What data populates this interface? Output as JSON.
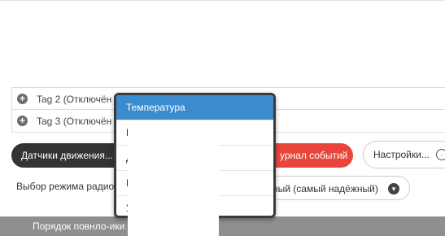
{
  "tags": [
    {
      "label": "Tag 2 (Отключён"
    },
    {
      "label": "Tag 3 (Отключён"
    }
  ],
  "buttons": {
    "motion_sensors": "Датчики движения...",
    "event_log": "урнал событий",
    "settings": "Настройки..."
  },
  "mode": {
    "label": "Выбор режима радио",
    "value": "дный (самый надёжный)"
  },
  "bottom_bar": {
    "label": "Порядок повнло-ики"
  },
  "dropdown": {
    "options": [
      {
        "label": "Температура",
        "selected": true
      },
      {
        "label": "Г",
        "selected": false
      },
      {
        "label": "Д",
        "selected": false
      },
      {
        "label": "Н                  и",
        "selected": false
      },
      {
        "label": "У",
        "selected": false
      }
    ]
  },
  "colors": {
    "accent": "#3b8ccf",
    "danger": "#e8463a",
    "dark_button": "#333333"
  },
  "icons": {
    "add": "plus-circle-icon",
    "settings": "gear-icon",
    "select": "chevron-down-icon"
  }
}
